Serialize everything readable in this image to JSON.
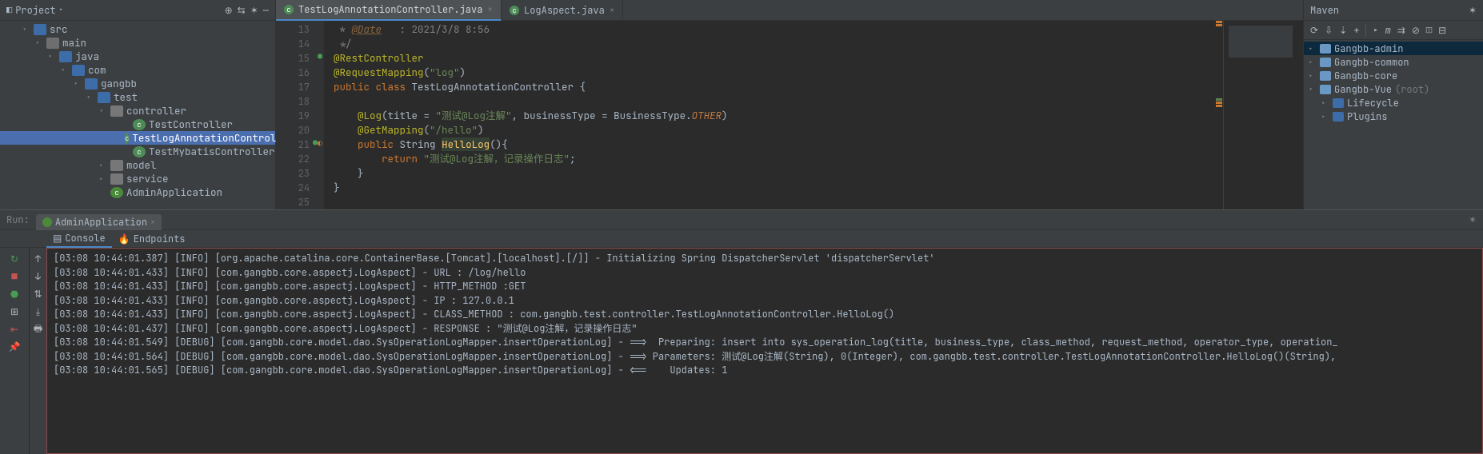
{
  "project": {
    "title": "Project",
    "tree": [
      {
        "pl": 28,
        "exp": "▾",
        "icon": "folder-b",
        "label": "src"
      },
      {
        "pl": 44,
        "exp": "▾",
        "icon": "folder-i",
        "label": "main"
      },
      {
        "pl": 60,
        "exp": "▾",
        "icon": "folder-b",
        "label": "java"
      },
      {
        "pl": 76,
        "exp": "▾",
        "icon": "folder-b",
        "label": "com"
      },
      {
        "pl": 92,
        "exp": "▾",
        "icon": "folder-b",
        "label": "gangbb"
      },
      {
        "pl": 108,
        "exp": "▾",
        "icon": "folder-b",
        "label": "test"
      },
      {
        "pl": 124,
        "exp": "▾",
        "icon": "pkg",
        "label": "controller"
      },
      {
        "pl": 152,
        "exp": "",
        "icon": "cls",
        "label": "TestController"
      },
      {
        "pl": 152,
        "exp": "",
        "icon": "cls",
        "label": "TestLogAnnotationController",
        "sel": true
      },
      {
        "pl": 152,
        "exp": "",
        "icon": "cls",
        "label": "TestMybatisController"
      },
      {
        "pl": 124,
        "exp": "▸",
        "icon": "pkg",
        "label": "model"
      },
      {
        "pl": 124,
        "exp": "▸",
        "icon": "pkg",
        "label": "service"
      },
      {
        "pl": 124,
        "exp": "",
        "icon": "cls2",
        "label": "AdminApplication"
      }
    ]
  },
  "editor": {
    "tabs": [
      {
        "icon": "cls",
        "label": "TestLogAnnotationController.java",
        "active": true
      },
      {
        "icon": "cls",
        "label": "LogAspect.java",
        "active": false
      }
    ],
    "startLine": 13,
    "endLine": 25
  },
  "maven": {
    "title": "Maven",
    "items": [
      {
        "pl": 6,
        "exp": "▸",
        "label": "Gangbb-admin",
        "sel": true
      },
      {
        "pl": 6,
        "exp": "▸",
        "label": "Gangbb-common"
      },
      {
        "pl": 6,
        "exp": "▸",
        "label": "Gangbb-core"
      },
      {
        "pl": 6,
        "exp": "▾",
        "label": "Gangbb-Vue",
        "suffix": "(root)"
      },
      {
        "pl": 22,
        "exp": "▸",
        "icon": "folder-blue",
        "label": "Lifecycle"
      },
      {
        "pl": 22,
        "exp": "▸",
        "icon": "folder-blue",
        "label": "Plugins"
      }
    ]
  },
  "run": {
    "label": "Run:",
    "tab": "AdminApplication",
    "sub": [
      {
        "label": "Console",
        "active": true
      },
      {
        "label": "Endpoints",
        "active": false
      }
    ],
    "lines": [
      "[03:08 10:44:01.387] [INFO] [org.apache.catalina.core.ContainerBase.[Tomcat].[localhost].[/]] - Initializing Spring DispatcherServlet 'dispatcherServlet'",
      "[03:08 10:44:01.433] [INFO] [com.gangbb.core.aspectj.LogAspect] - URL : /log/hello",
      "[03:08 10:44:01.433] [INFO] [com.gangbb.core.aspectj.LogAspect] - HTTP_METHOD :GET",
      "[03:08 10:44:01.433] [INFO] [com.gangbb.core.aspectj.LogAspect] - IP : 127.0.0.1",
      "[03:08 10:44:01.433] [INFO] [com.gangbb.core.aspectj.LogAspect] - CLASS_METHOD : com.gangbb.test.controller.TestLogAnnotationController.HelloLog()",
      "[03:08 10:44:01.437] [INFO] [com.gangbb.core.aspectj.LogAspect] - RESPONSE : \"测试@Log注解，记录操作日志\"",
      "[03:08 10:44:01.549] [DEBUG] [com.gangbb.core.model.dao.SysOperationLogMapper.insertOperationLog] - ==>  Preparing: insert into sys_operation_log(title, business_type, class_method, request_method, operator_type, operation_",
      "[03:08 10:44:01.564] [DEBUG] [com.gangbb.core.model.dao.SysOperationLogMapper.insertOperationLog] - ==> Parameters: 测试@Log注解(String), 0(Integer), com.gangbb.test.controller.TestLogAnnotationController.HelloLog()(String),",
      "[03:08 10:44:01.565] [DEBUG] [com.gangbb.core.model.dao.SysOperationLogMapper.insertOperationLog] - <==    Updates: 1"
    ]
  }
}
